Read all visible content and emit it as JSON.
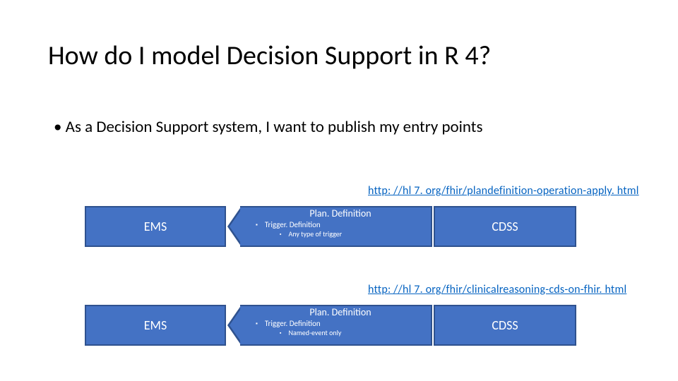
{
  "title": "How do I model Decision Support in R 4?",
  "main_bullet": "As a Decision Support system, I want to publish my entry points",
  "links": {
    "row1": "http: //hl 7. org/fhir/plandefinition-operation-apply. html",
    "row2": "http: //hl 7. org/fhir/clinicalreasoning-cds-on-fhir. html"
  },
  "rows": [
    {
      "left": "EMS",
      "arrow_title": "Plan. Definition",
      "arrow_line1": "Trigger. Definition",
      "arrow_line2": "Any type of trigger",
      "right": "CDSS"
    },
    {
      "left": "EMS",
      "arrow_title": "Plan. Definition",
      "arrow_line1": "Trigger. Definition",
      "arrow_line2": "Named-event only",
      "right": "CDSS"
    }
  ]
}
